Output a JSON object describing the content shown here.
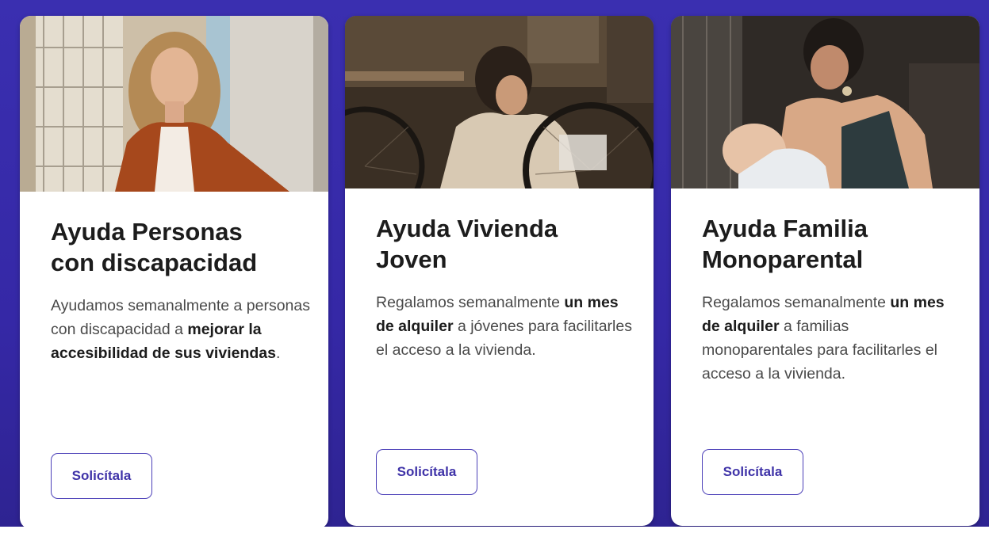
{
  "cards": [
    {
      "title_line1": "Ayuda Personas",
      "title_line2": "con discapacidad",
      "desc": {
        "p1": "Ayudamos semanalmente a personas con discapacidad a ",
        "b1": "mejorar la accesibilidad de sus viviendas",
        "p2": "."
      },
      "button": "Solicítala",
      "photo": "smiling-woman-in-cardigan-photo"
    },
    {
      "title_line1": "Ayuda Vivienda",
      "title_line2": "Joven",
      "desc": {
        "p1": "Regalamos semanalmente ",
        "b1": "un mes de alquiler",
        "p2": " a jóvenes para facilitarles el acceso a la vivienda."
      },
      "button": "Solicítala",
      "photo": "young-woman-fixing-bicycle-photo"
    },
    {
      "title_line1": "Ayuda Familia",
      "title_line2": "Monoparental",
      "desc": {
        "p1": "Regalamos semanalmente ",
        "b1": "un mes de alquiler",
        "p2": " a familias monoparentales para facilitarles el acceso a la vivienda."
      },
      "button": "Solicítala",
      "photo": "mother-breastfeeding-baby-photo"
    }
  ],
  "colors": {
    "background": "#3a2fb0",
    "card": "#ffffff",
    "button_text": "#3f33a8",
    "button_border": "#4b3fb8",
    "title_text": "#1c1c1c",
    "body_text": "#4a4a4a"
  }
}
